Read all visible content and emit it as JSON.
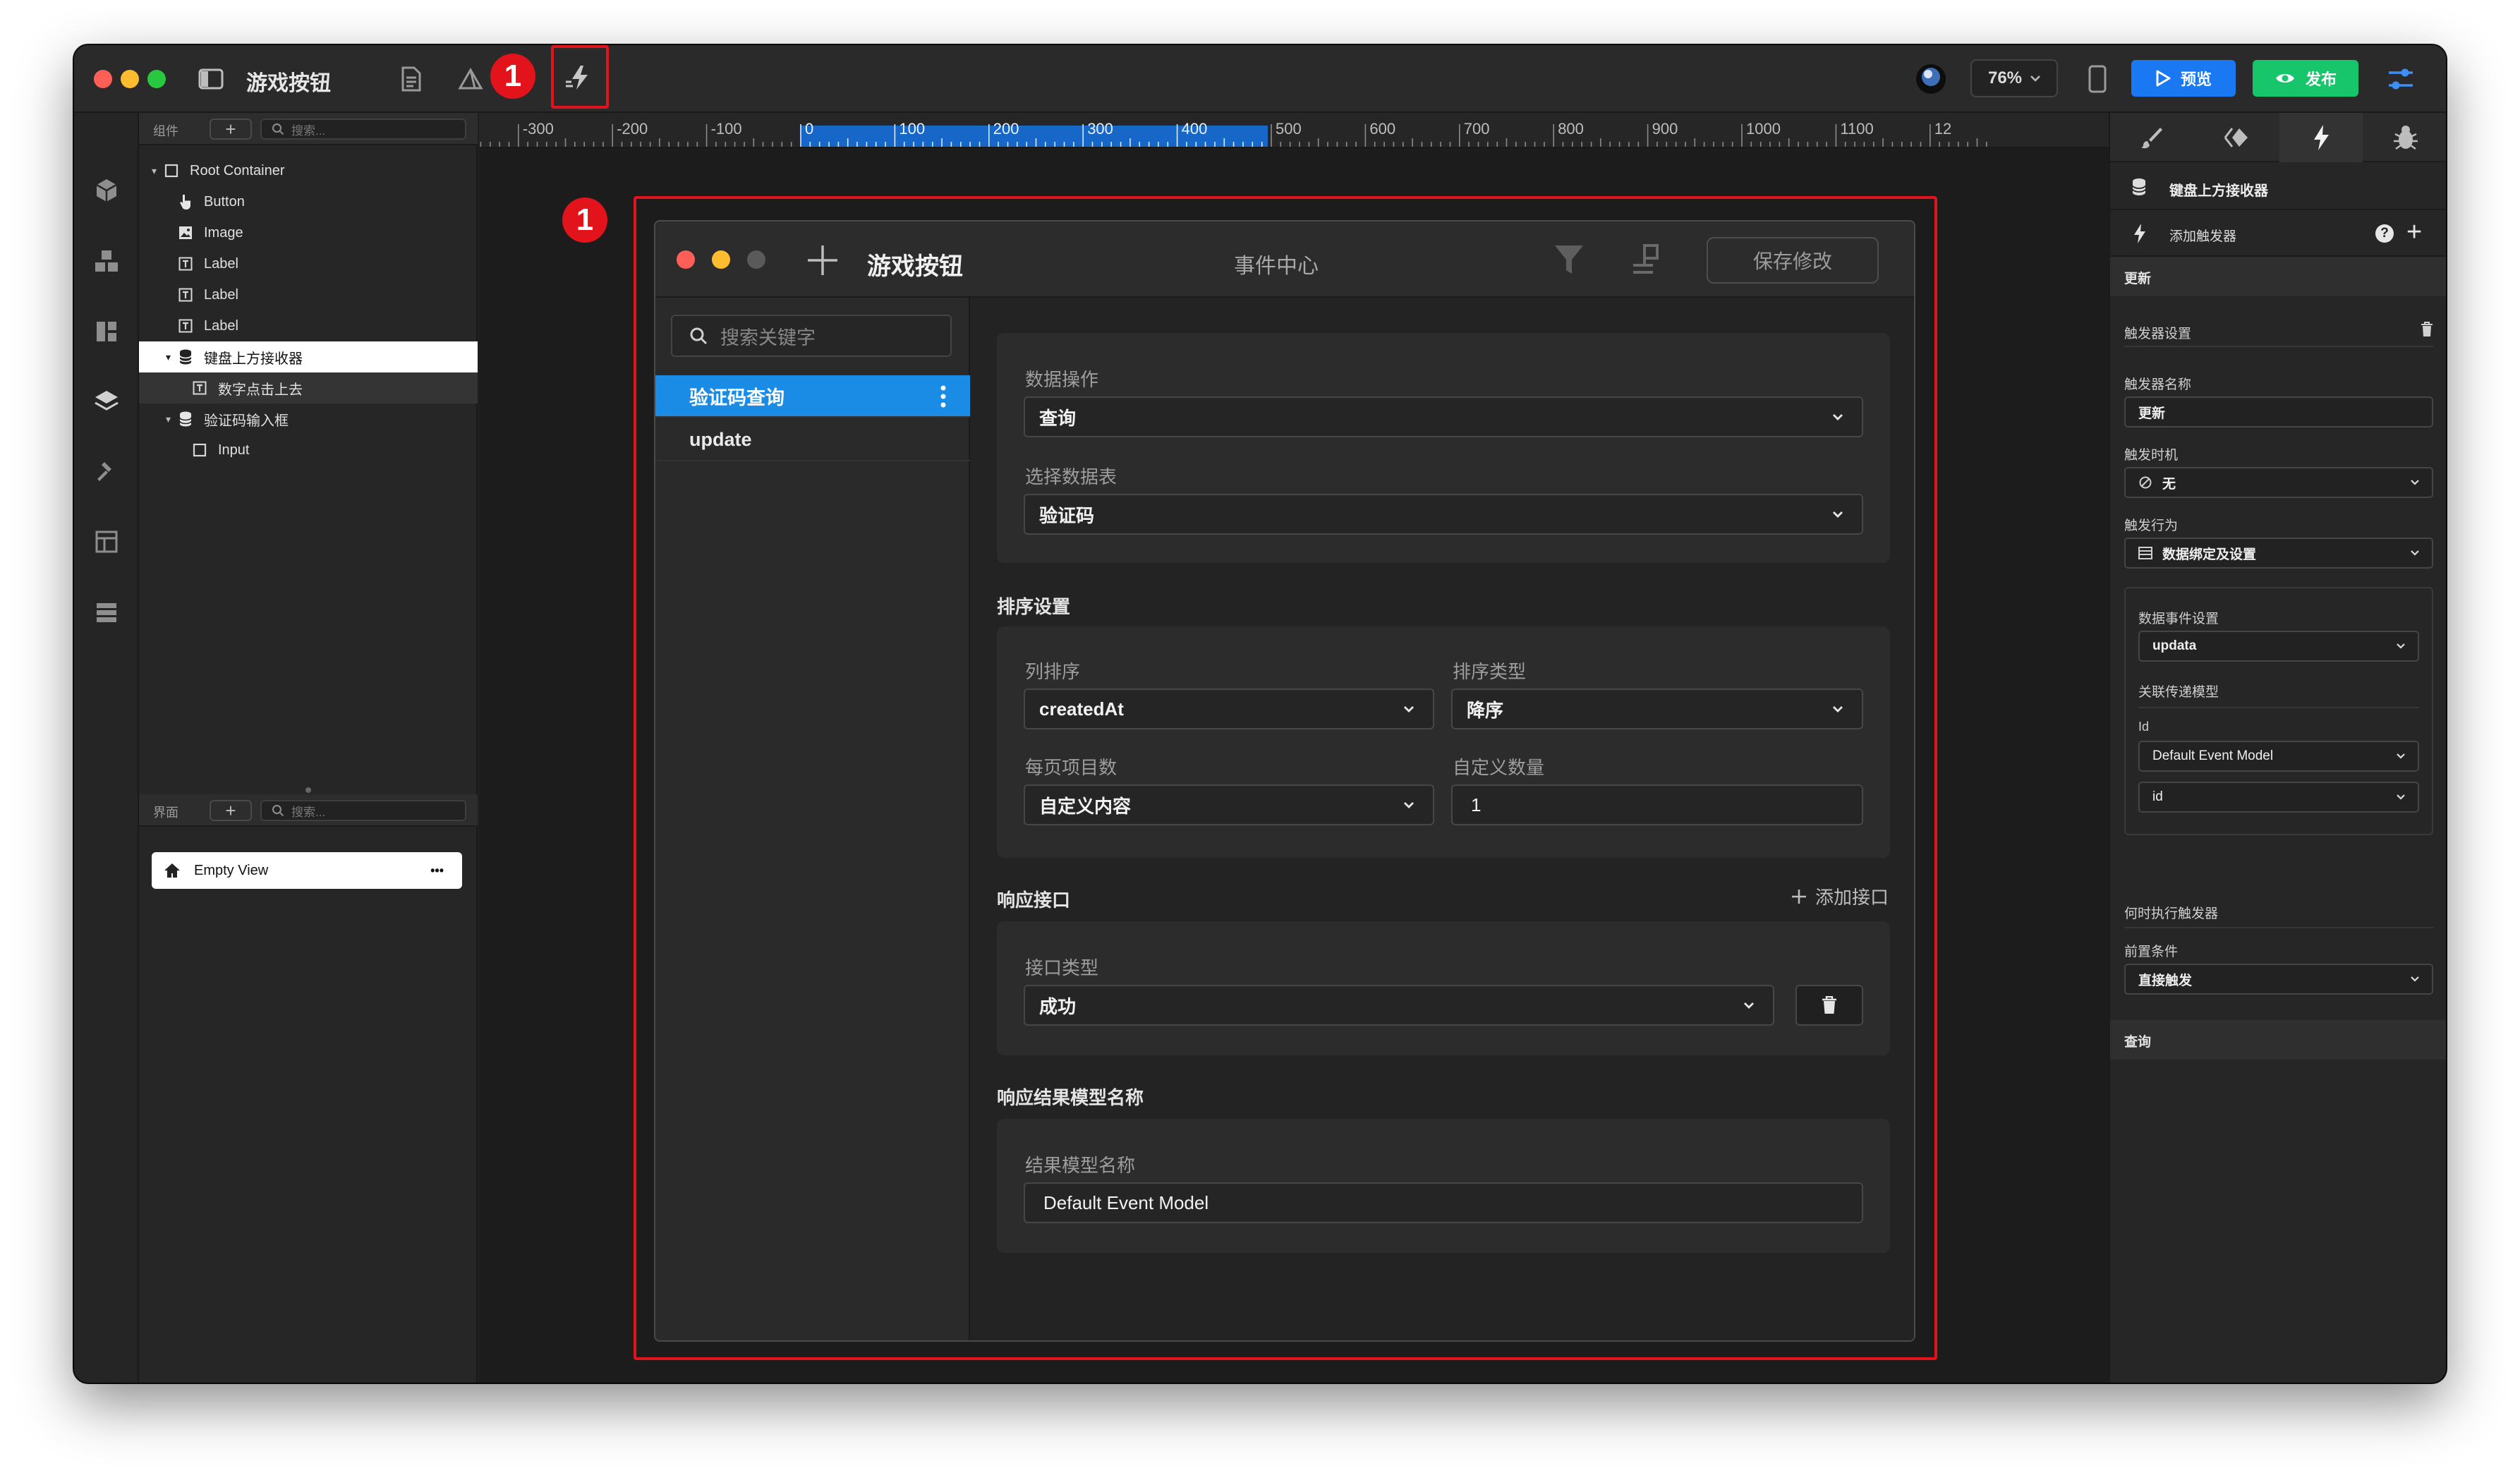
{
  "titlebar": {
    "title": "游戏按钮",
    "zoom": "76%",
    "preview_label": "预览",
    "publish_label": "发布",
    "marker_number": "1"
  },
  "components_panel": {
    "header_label": "组件",
    "search_placeholder": "搜索...",
    "tree": [
      {
        "label": "Root Container",
        "icon": "square-icon",
        "depth": 0,
        "caret": true
      },
      {
        "label": "Button",
        "icon": "pointer-icon",
        "depth": 1
      },
      {
        "label": "Image",
        "icon": "image-icon",
        "depth": 1
      },
      {
        "label": "Label",
        "icon": "text-icon",
        "depth": 1
      },
      {
        "label": "Label",
        "icon": "text-icon",
        "depth": 1
      },
      {
        "label": "Label",
        "icon": "text-icon",
        "depth": 1
      },
      {
        "label": "键盘上方接收器",
        "icon": "database-icon",
        "depth": 1,
        "caret": true,
        "selected": true
      },
      {
        "label": "数字点击上去",
        "icon": "text-icon",
        "depth": 2
      },
      {
        "label": "验证码输入框",
        "icon": "database-icon",
        "depth": 1,
        "caret": true
      },
      {
        "label": "Input",
        "icon": "square-icon",
        "depth": 2
      }
    ]
  },
  "views_panel": {
    "header_label": "界面",
    "search_placeholder": "搜索...",
    "view_name": "Empty View",
    "more": "•••"
  },
  "ruler": {
    "labels": [
      "-300",
      "-200",
      "-100",
      "0",
      "100",
      "200",
      "300",
      "400",
      "500",
      "600",
      "700",
      "800",
      "900",
      "1000",
      "1100",
      "12"
    ]
  },
  "dialog": {
    "title": "游戏按钮",
    "center_label": "事件中心",
    "save_label": "保存修改",
    "marker_number": "1",
    "search_placeholder": "搜索关键字",
    "events": [
      {
        "label": "验证码查询",
        "active": true
      },
      {
        "label": "update",
        "active": false
      }
    ],
    "data_op": {
      "label": "数据操作",
      "value": "查询",
      "table_label": "选择数据表",
      "table_value": "验证码"
    },
    "sort": {
      "section_title": "排序设置",
      "column_label": "列排序",
      "column_value": "createdAt",
      "type_label": "排序类型",
      "type_value": "降序",
      "page_label": "每页项目数",
      "page_value": "自定义内容",
      "custom_label": "自定义数量",
      "custom_value": "1"
    },
    "response": {
      "section_title": "响应接口",
      "add_label": "添加接口",
      "type_label": "接口类型",
      "type_value": "成功"
    },
    "result_model": {
      "section_title": "响应结果模型名称",
      "label": "结果模型名称",
      "value": "Default Event Model"
    }
  },
  "inspector": {
    "component_name": "键盘上方接收器",
    "add_trigger_label": "添加触发器",
    "help": "?",
    "trigger_item": "更新",
    "trigger_settings": "触发器设置",
    "trigger_name_label": "触发器名称",
    "trigger_name_value": "更新",
    "trigger_time_label": "触发时机",
    "trigger_time_value": "无",
    "trigger_action_label": "触发行为",
    "trigger_action_value": "数据绑定及设置",
    "data_event_label": "数据事件设置",
    "data_event_value": "updata",
    "relay_model_label": "关联传递模型",
    "id_label": "Id",
    "model_value": "Default Event Model",
    "field_value": "id",
    "when_exec": "何时执行触发器",
    "precondition_label": "前置条件",
    "precondition_value": "直接触发",
    "query_item": "查询"
  }
}
